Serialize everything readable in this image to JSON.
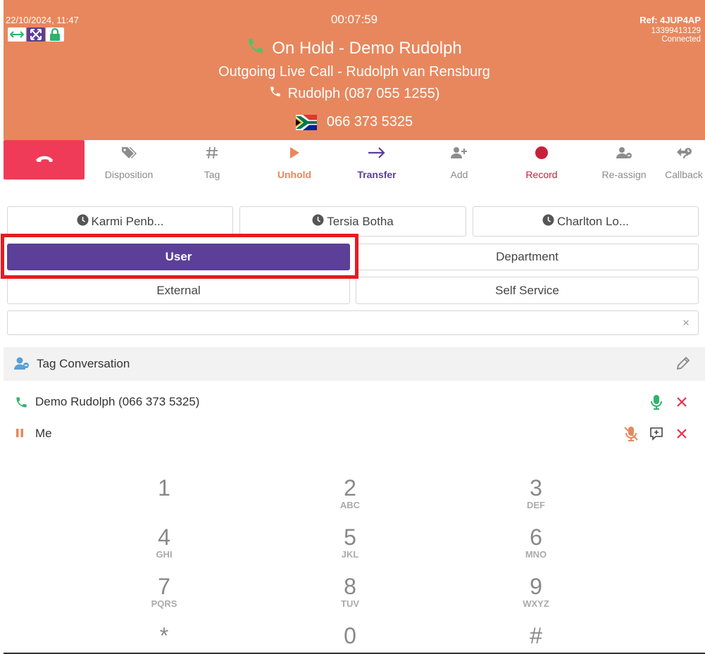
{
  "header": {
    "datetime": "22/10/2024, 11:47",
    "timer": "00:07:59",
    "ref": "Ref: 4JUP4AP",
    "ref_number": "13399413129",
    "ref_status": "Connected",
    "title": "On Hold - Demo Rudolph",
    "subtitle": "Outgoing Live Call - Rudolph van Rensburg",
    "caller": "Rudolph (087 055 1255)",
    "number": "066 373 5325",
    "icons": [
      "swap-arrows-icon",
      "expand-icon",
      "lock-icon"
    ],
    "colors": {
      "background": "#e8875d"
    }
  },
  "toolbar": {
    "hangup_icon": "hangup-phone-icon",
    "items": [
      {
        "label": "Disposition",
        "icon": "tags-icon"
      },
      {
        "label": "Tag",
        "icon": "hash-icon"
      },
      {
        "label": "Unhold",
        "icon": "play-icon",
        "color": "#e8875d"
      },
      {
        "label": "Transfer",
        "icon": "arrow-right-icon",
        "color": "#5c3f99"
      },
      {
        "label": "Add",
        "icon": "user-plus-icon"
      },
      {
        "label": "Record",
        "icon": "record-dot-icon",
        "color": "#c8203b"
      },
      {
        "label": "Re-assign",
        "icon": "user-reassign-icon"
      },
      {
        "label": "Callback",
        "icon": "callback-icon"
      }
    ]
  },
  "recent": [
    "Karmi Penb...",
    "Tersia Botha",
    "Charlton Lo..."
  ],
  "filters": {
    "user": "User",
    "department": "Department",
    "external": "External",
    "self_service": "Self Service"
  },
  "search": {
    "value": "",
    "placeholder": "",
    "clear": "×"
  },
  "tag_conversation": {
    "label": "Tag Conversation"
  },
  "participants": [
    {
      "name": "Demo Rudolph (066 373 5325)"
    },
    {
      "name": "Me"
    }
  ],
  "keypad": [
    {
      "digit": "1",
      "letters": ""
    },
    {
      "digit": "2",
      "letters": "ABC"
    },
    {
      "digit": "3",
      "letters": "DEF"
    },
    {
      "digit": "4",
      "letters": "GHI"
    },
    {
      "digit": "5",
      "letters": "JKL"
    },
    {
      "digit": "6",
      "letters": "MNO"
    },
    {
      "digit": "7",
      "letters": "PQRS"
    },
    {
      "digit": "8",
      "letters": "TUV"
    },
    {
      "digit": "9",
      "letters": "WXYZ"
    },
    {
      "digit": "*",
      "letters": ""
    },
    {
      "digit": "0",
      "letters": ""
    },
    {
      "digit": "#",
      "letters": ""
    }
  ]
}
